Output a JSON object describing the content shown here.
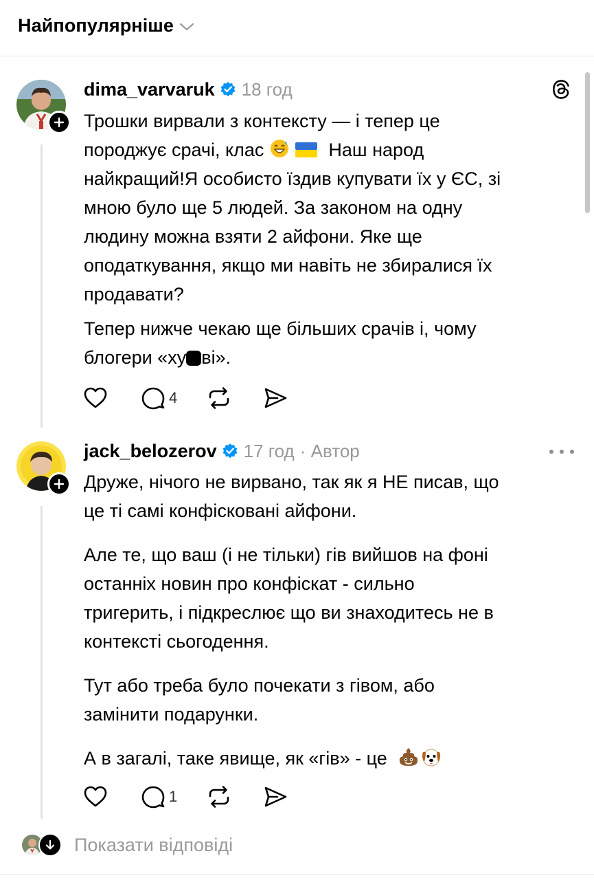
{
  "header": {
    "sort_label": "Найпопулярніше"
  },
  "threads": [
    {
      "username": "dima_varvaruk",
      "time": "18 год",
      "author_tag": "",
      "lines": [
        "Трошки вирвали з контексту — і тепер це",
        "породжує срачі, клас",
        "найкращий!Я особисто їздив купувати їх у ЄС, зі",
        "мною було ще 5 людей. За законом на одну",
        "людину можна взяти 2 айфони. Яке ще",
        "оподаткування, якщо ми навіть не збиралися їх",
        "продавати?",
        "Тепер нижче чекаю ще більших срачів і, чому",
        "блогери «ху",
        "ві»."
      ],
      "line2_suffix": "Наш народ",
      "reply_count": "4"
    },
    {
      "username": "jack_belozerov",
      "time": "17 год",
      "author_tag": "· Автор",
      "paragraphs": [
        [
          "Друже, нічого не вирвано, так як я НЕ писав, що",
          "це ті самі конфісковані айфони."
        ],
        [
          "Але те, що ваш (і не тільки) гів вийшов на фоні",
          "останніх новин про конфіскат - сильно",
          "тригерить, і підкреслює що ви знаходитесь не в",
          "контексті сьогодення."
        ],
        [
          "Тут або треба було почекати з гівом, або",
          "замінити подарунки."
        ],
        [
          "А в загалі, таке явище, як «гів» - це"
        ]
      ],
      "reply_count": "1"
    }
  ],
  "show_replies": {
    "label": "Показати відповіді"
  },
  "icons": {
    "sort": "chevron-down-icon",
    "threads_logo": "threads-logo-icon",
    "verified": "verified-badge-icon",
    "like": "heart-icon",
    "comment": "comment-icon",
    "repost": "repost-icon",
    "share": "send-icon",
    "more": "more-dots-icon"
  },
  "colors": {
    "verified": "#0095f6",
    "meta": "#999999",
    "text": "#000000"
  }
}
